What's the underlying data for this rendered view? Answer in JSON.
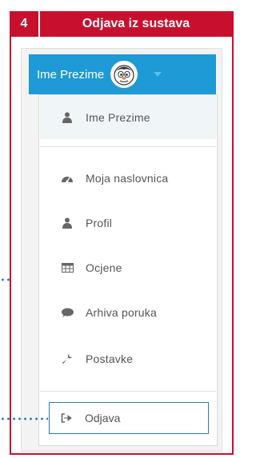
{
  "header": {
    "step_number": "4",
    "title": "Odjava iz sustava",
    "accent_color": "#c8102e"
  },
  "user_bar": {
    "name": "Ime Prezime",
    "bar_color": "#1e9ad6",
    "avatar_icon": "cartoon-face-avatar",
    "caret_icon": "caret-down-icon"
  },
  "menu": {
    "items": [
      {
        "label": "Ime Prezime",
        "icon": "user-icon"
      },
      {
        "label": "Moja naslovnica",
        "icon": "dashboard-icon"
      },
      {
        "label": "Profil",
        "icon": "user-icon"
      },
      {
        "label": "Ocjene",
        "icon": "table-icon"
      },
      {
        "label": "Arhiva poruka",
        "icon": "comment-icon"
      },
      {
        "label": "Postavke",
        "icon": "wrench-icon"
      }
    ],
    "logout": {
      "label": "Odjava",
      "icon": "sign-out-icon",
      "highlight_color": "#2b7ab8"
    }
  }
}
